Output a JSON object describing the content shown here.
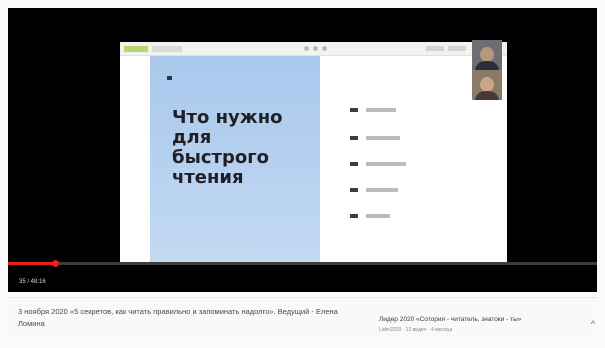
{
  "slide": {
    "title": "Что нужно\nдля\nбыстрого\nчтения",
    "agenda_items": [
      {
        "id": "agenda-1",
        "line_width": 30
      },
      {
        "id": "agenda-2",
        "line_width": 34
      },
      {
        "id": "agenda-3",
        "line_width": 40
      },
      {
        "id": "agenda-4",
        "line_width": 32
      },
      {
        "id": "agenda-5",
        "line_width": 24
      }
    ]
  },
  "player": {
    "timecode": "35 / 48:16",
    "progress": 0.08
  },
  "caption": {
    "title": "3 ноября 2020 «5 секретов, как читать правильно и запоминать надолго». Ведущий - Елена Ломина",
    "next_title": "Лидер 2020 «Сотория - читатель, знатоки - ты»",
    "next_meta": "Lider2020 · 13 видео · 4 месяца"
  },
  "colors": {
    "slide_panel": "#b6d0ef",
    "progress": "#e62117",
    "logo_accent": "#b9d36d"
  },
  "icons": {
    "expand": "chevron-up-icon"
  }
}
